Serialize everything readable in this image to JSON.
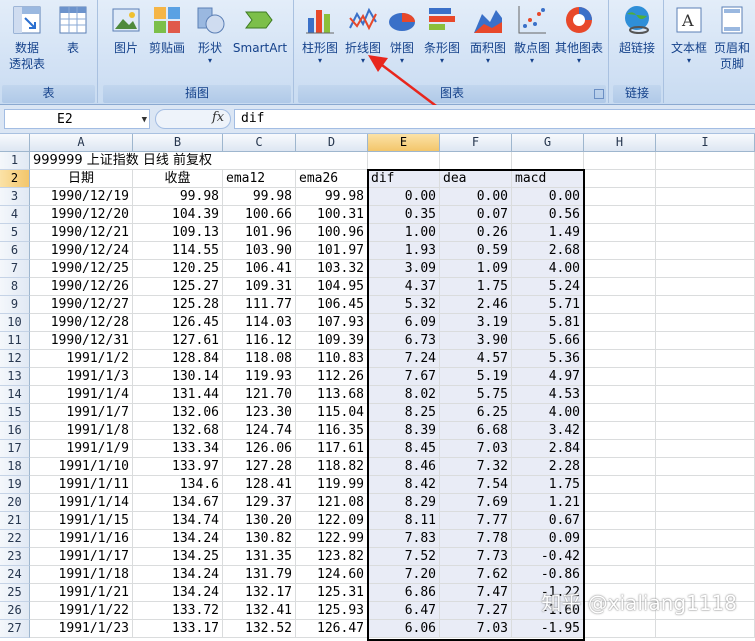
{
  "ribbon": {
    "groups": [
      {
        "label": "表"
      },
      {
        "label": "插图"
      },
      {
        "label": "图表"
      },
      {
        "label": "链接"
      }
    ],
    "buttons": [
      {
        "label": "数据\n透视表",
        "caret": "▾"
      },
      {
        "label": "表"
      },
      {
        "label": "图片"
      },
      {
        "label": "剪贴画"
      },
      {
        "label": "形状",
        "caret": "▾"
      },
      {
        "label": "SmartArt"
      },
      {
        "label": "柱形图",
        "caret": "▾"
      },
      {
        "label": "折线图",
        "caret": "▾"
      },
      {
        "label": "饼图",
        "caret": "▾"
      },
      {
        "label": "条形图",
        "caret": "▾"
      },
      {
        "label": "面积图",
        "caret": "▾"
      },
      {
        "label": "散点图",
        "caret": "▾"
      },
      {
        "label": "其他图表",
        "caret": "▾"
      },
      {
        "label": "超链接"
      },
      {
        "label": "文本框",
        "caret": "▾"
      },
      {
        "label": "页眉和\n页脚"
      }
    ]
  },
  "formula_bar": {
    "name_box": "E2",
    "fx": "fx",
    "content": "dif"
  },
  "sheet": {
    "columns": [
      "A",
      "B",
      "C",
      "D",
      "E",
      "F",
      "G",
      "H",
      "I"
    ],
    "title": "999999 上证指数 日线 前复权",
    "headers": [
      "日期",
      "收盘",
      "ema12",
      "ema26",
      "dif",
      "dea",
      "macd"
    ],
    "rows": [
      [
        "1990/12/19",
        "99.98",
        "99.98",
        "99.98",
        "0.00",
        "0.00",
        "0.00"
      ],
      [
        "1990/12/20",
        "104.39",
        "100.66",
        "100.31",
        "0.35",
        "0.07",
        "0.56"
      ],
      [
        "1990/12/21",
        "109.13",
        "101.96",
        "100.96",
        "1.00",
        "0.26",
        "1.49"
      ],
      [
        "1990/12/24",
        "114.55",
        "103.90",
        "101.97",
        "1.93",
        "0.59",
        "2.68"
      ],
      [
        "1990/12/25",
        "120.25",
        "106.41",
        "103.32",
        "3.09",
        "1.09",
        "4.00"
      ],
      [
        "1990/12/26",
        "125.27",
        "109.31",
        "104.95",
        "4.37",
        "1.75",
        "5.24"
      ],
      [
        "1990/12/27",
        "125.28",
        "111.77",
        "106.45",
        "5.32",
        "2.46",
        "5.71"
      ],
      [
        "1990/12/28",
        "126.45",
        "114.03",
        "107.93",
        "6.09",
        "3.19",
        "5.81"
      ],
      [
        "1990/12/31",
        "127.61",
        "116.12",
        "109.39",
        "6.73",
        "3.90",
        "5.66"
      ],
      [
        "1991/1/2",
        "128.84",
        "118.08",
        "110.83",
        "7.24",
        "4.57",
        "5.36"
      ],
      [
        "1991/1/3",
        "130.14",
        "119.93",
        "112.26",
        "7.67",
        "5.19",
        "4.97"
      ],
      [
        "1991/1/4",
        "131.44",
        "121.70",
        "113.68",
        "8.02",
        "5.75",
        "4.53"
      ],
      [
        "1991/1/7",
        "132.06",
        "123.30",
        "115.04",
        "8.25",
        "6.25",
        "4.00"
      ],
      [
        "1991/1/8",
        "132.68",
        "124.74",
        "116.35",
        "8.39",
        "6.68",
        "3.42"
      ],
      [
        "1991/1/9",
        "133.34",
        "126.06",
        "117.61",
        "8.45",
        "7.03",
        "2.84"
      ],
      [
        "1991/1/10",
        "133.97",
        "127.28",
        "118.82",
        "8.46",
        "7.32",
        "2.28"
      ],
      [
        "1991/1/11",
        "134.6",
        "128.41",
        "119.99",
        "8.42",
        "7.54",
        "1.75"
      ],
      [
        "1991/1/14",
        "134.67",
        "129.37",
        "121.08",
        "8.29",
        "7.69",
        "1.21"
      ],
      [
        "1991/1/15",
        "134.74",
        "130.20",
        "122.09",
        "8.11",
        "7.77",
        "0.67"
      ],
      [
        "1991/1/16",
        "134.24",
        "130.82",
        "122.99",
        "7.83",
        "7.78",
        "0.09"
      ],
      [
        "1991/1/17",
        "134.25",
        "131.35",
        "123.82",
        "7.52",
        "7.73",
        "-0.42"
      ],
      [
        "1991/1/18",
        "134.24",
        "131.79",
        "124.60",
        "7.20",
        "7.62",
        "-0.86"
      ],
      [
        "1991/1/21",
        "134.24",
        "132.17",
        "125.31",
        "6.86",
        "7.47",
        "-1.22"
      ],
      [
        "1991/1/22",
        "133.72",
        "132.41",
        "125.93",
        "6.47",
        "7.27",
        "-1.60"
      ],
      [
        "1991/1/23",
        "133.17",
        "132.52",
        "126.47",
        "6.06",
        "7.03",
        "-1.95"
      ]
    ],
    "row_numbers": [
      "1",
      "2",
      "3",
      "4",
      "5",
      "6",
      "7",
      "8",
      "9",
      "10",
      "11",
      "12",
      "13",
      "14",
      "15",
      "16",
      "17",
      "18",
      "19",
      "20",
      "21",
      "22",
      "23",
      "24",
      "25",
      "26",
      "27"
    ]
  },
  "watermark": "知乎 @xialiang1118",
  "colors": {
    "ribbon_text": "#15428b",
    "selected_header": "#f3c66b",
    "shaded_cells": "#e9ecf6",
    "arrow": "#e8261d"
  }
}
